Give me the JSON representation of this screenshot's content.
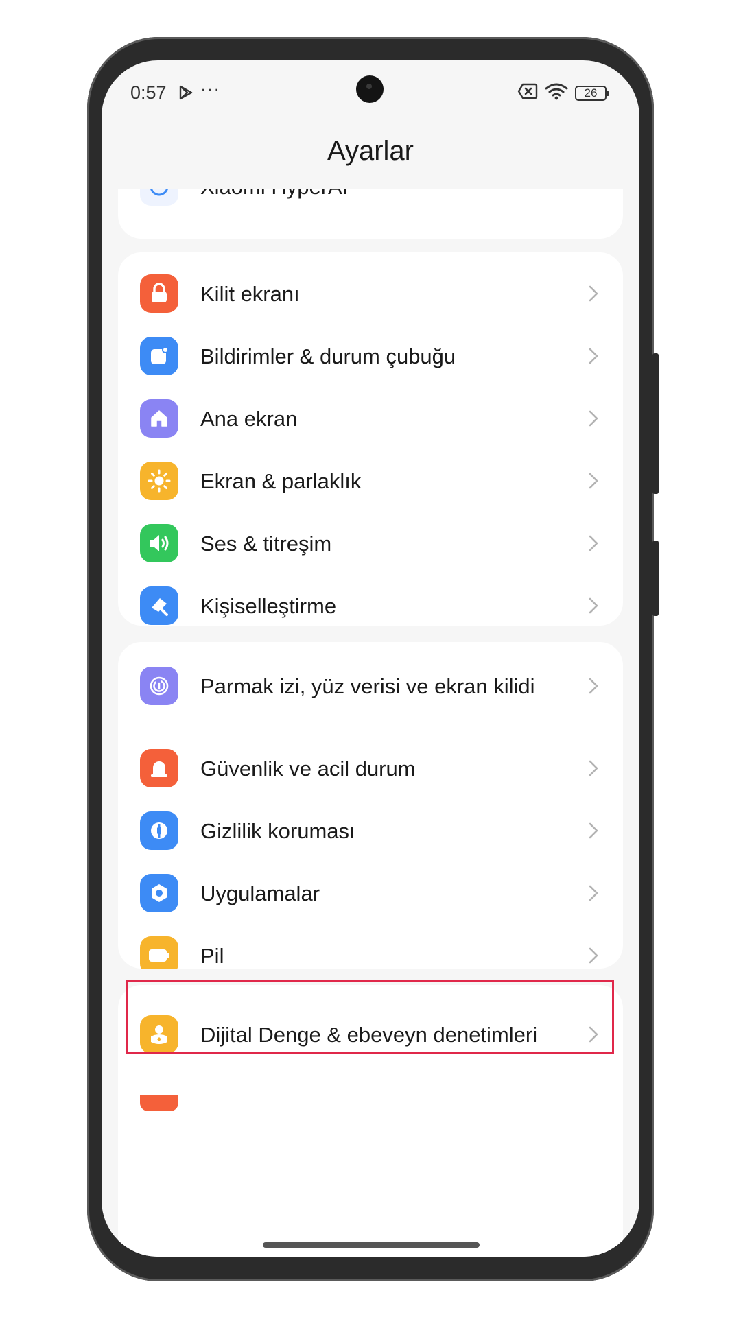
{
  "status_bar": {
    "time": "0:57",
    "more": "···",
    "battery": "26"
  },
  "header": {
    "title": "Ayarlar"
  },
  "partial_item": {
    "label": "Xiaomi HyperAI"
  },
  "groups": [
    {
      "items": [
        {
          "label": "Kilit ekranı",
          "icon": "lock-icon",
          "color": "#f4603a"
        },
        {
          "label": "Bildirimler & durum çubuğu",
          "icon": "notification-icon",
          "color": "#3d8bf5"
        },
        {
          "label": "Ana ekran",
          "icon": "home-icon",
          "color": "#8a84f3"
        },
        {
          "label": "Ekran & parlaklık",
          "icon": "sun-icon",
          "color": "#f7b42c"
        },
        {
          "label": "Ses & titreşim",
          "icon": "speaker-icon",
          "color": "#33c75c"
        },
        {
          "label": "Kişiselleştirme",
          "icon": "brush-icon",
          "color": "#3d8bf5"
        }
      ]
    },
    {
      "items": [
        {
          "label": "Parmak izi, yüz verisi ve ekran kilidi",
          "icon": "fingerprint-icon",
          "color": "#8a84f3"
        },
        {
          "label": "Güvenlik ve acil durum",
          "icon": "alarm-icon",
          "color": "#f4603a"
        },
        {
          "label": "Gizlilik koruması",
          "icon": "privacy-icon",
          "color": "#3d8bf5"
        },
        {
          "label": "Uygulamalar",
          "icon": "apps-icon",
          "color": "#3d8bf5"
        },
        {
          "label": "Pil",
          "icon": "battery-icon",
          "color": "#f7b42c"
        }
      ]
    },
    {
      "items": [
        {
          "label": "Dijital Denge & ebeveyn denetimleri",
          "icon": "digital-balance-icon",
          "color": "#f7b42c"
        }
      ]
    }
  ]
}
